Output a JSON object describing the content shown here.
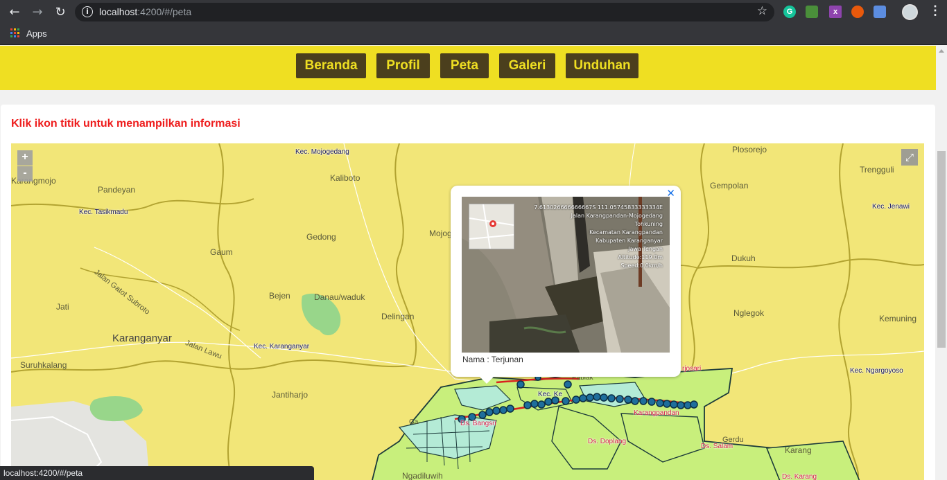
{
  "browser": {
    "url_host": "localhost",
    "url_rest": ":4200/#/peta",
    "bookmarks": {
      "apps_label": "Apps"
    },
    "status_text": "localhost:4200/#/peta"
  },
  "navbar": {
    "items": [
      {
        "label": "Beranda"
      },
      {
        "label": "Profil"
      },
      {
        "label": "Peta"
      },
      {
        "label": "Galeri"
      },
      {
        "label": "Unduhan"
      }
    ]
  },
  "main": {
    "title": "Klik ikon titik untuk menampilkan informasi"
  },
  "map": {
    "zoom_in": "+",
    "zoom_out": "-",
    "places": {
      "kec_mojogedang": "Kec. Mojogedang",
      "karangmojo": "Karangmojo",
      "pandeyan": "Pandeyan",
      "kaliboto": "Kaliboto",
      "kec_tasikmadu": "Kec. Tasikmadu",
      "gedong": "Gedong",
      "mojog": "Mojog",
      "gaum": "Gaum",
      "jalan_gatot": "Jalan Gatot Subroto",
      "bejen": "Bejen",
      "danau": "Danau/waduk",
      "jati": "Jati",
      "delingan": "Delingan",
      "karanganyar": "Karanganyar",
      "jalan_lawu": "Jalan Lawu",
      "kec_karanganyar": "Kec. Karanganyar",
      "suruhkalang": "Suruhkalang",
      "jantiharjo": "Jantiharjo",
      "plosorejo": "Plosorejo",
      "trengguli": "Trengguli",
      "gempolan": "Gempolan",
      "kec_jenawi": "Kec. Jenawi",
      "dukuh": "Dukuh",
      "nglegok": "Nglegok",
      "kemuning": "Kemuning",
      "kec_ngargoyoso": "Kec. Ngargoyoso",
      "ngadiluwih": "Ngadiluwih",
      "gerdu": "Gerdu",
      "karang": "Karang",
      "ds_doplang": "Ds. Doplang",
      "ds_salam": "Ds. Salam",
      "ds_karang": "Ds. Karang",
      "karangpandan": "Karangpandan",
      "harjosari": "rjosari",
      "ds_bangsri": "Ds. Bangsri",
      "kec_ke": "Kec. Ke",
      "pablak": "Pablak",
      "ga": "Ga"
    },
    "popup": {
      "close": "✕",
      "name": "Nama : Terjunan",
      "photo_overlay": [
        "7.613026666666667S 111.05745833333334E",
        "Jalan Karangpandan-Mojogedang",
        "Tohkuning",
        "Kecamatan Karangpandan",
        "Kabupaten Karanganyar",
        "Jawa Tengah",
        "Altitude:119.0m",
        "Speed:0.0km/h"
      ]
    }
  },
  "colors": {
    "navbar_bg": "#efdf22",
    "nav_button_bg": "#4b3f1d",
    "title_red": "#ee1c1c",
    "map_yellow": "#f2e678",
    "polygon_green": "#c8ef7c",
    "marker_blue": "#1e6e9c"
  }
}
